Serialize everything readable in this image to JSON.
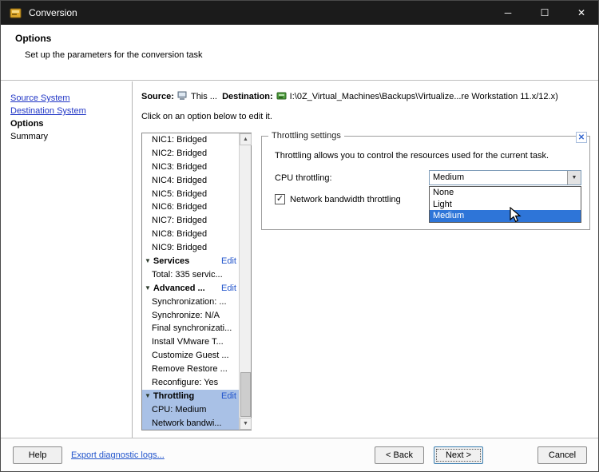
{
  "window": {
    "title": "Conversion",
    "controls": {
      "minimize": "─",
      "maximize": "☐",
      "close": "✕"
    }
  },
  "header": {
    "title": "Options",
    "subtitle": "Set up the parameters for the conversion task"
  },
  "wizard_nav": [
    {
      "label": "Source System"
    },
    {
      "label": "Destination System"
    },
    {
      "label": "Options"
    },
    {
      "label": "Summary"
    }
  ],
  "source_line": {
    "source_label": "Source:",
    "source_value": "This ...",
    "destination_label": "Destination:",
    "destination_value": "I:\\0Z_Virtual_Machines\\Backups\\Virtualize...re Workstation 11.x/12.x)"
  },
  "instruction": "Click on an option below to edit it.",
  "options_list": [
    {
      "label": "NIC1: Bridged",
      "type": "item"
    },
    {
      "label": "NIC2: Bridged",
      "type": "item"
    },
    {
      "label": "NIC3: Bridged",
      "type": "item"
    },
    {
      "label": "NIC4: Bridged",
      "type": "item"
    },
    {
      "label": "NIC5: Bridged",
      "type": "item"
    },
    {
      "label": "NIC6: Bridged",
      "type": "item"
    },
    {
      "label": "NIC7: Bridged",
      "type": "item"
    },
    {
      "label": "NIC8: Bridged",
      "type": "item"
    },
    {
      "label": "NIC9: Bridged",
      "type": "item"
    },
    {
      "label": "Services",
      "edit": "Edit",
      "type": "section"
    },
    {
      "label": "Total: 335 servic...",
      "type": "item"
    },
    {
      "label": "Advanced ...",
      "edit": "Edit",
      "type": "section"
    },
    {
      "label": "Synchronization: ...",
      "type": "item"
    },
    {
      "label": "Synchronize: N/A",
      "type": "item"
    },
    {
      "label": "Final synchronizati...",
      "type": "item"
    },
    {
      "label": "Install VMware T...",
      "type": "item"
    },
    {
      "label": "Customize Guest ...",
      "type": "item"
    },
    {
      "label": "Remove Restore ...",
      "type": "item"
    },
    {
      "label": "Reconfigure: Yes",
      "type": "item"
    },
    {
      "label": "Throttling",
      "edit": "Edit",
      "type": "section",
      "selected": true
    },
    {
      "label": "CPU: Medium",
      "type": "item",
      "selected": true
    },
    {
      "label": "Network bandwi...",
      "type": "item",
      "selected": true
    }
  ],
  "throttling_panel": {
    "title": "Throttling settings",
    "close_glyph": "✕",
    "description": "Throttling allows you to control the resources used for the current task.",
    "cpu_label": "CPU throttling:",
    "cpu_value": "Medium",
    "checkbox_label": "Network bandwidth throttling",
    "checkbox_checked": true,
    "checkbox_glyph": "✓",
    "dropdown_options": [
      "None",
      "Light",
      "Medium"
    ],
    "dropdown_selected": "Medium"
  },
  "footer": {
    "help": "Help",
    "export_link": "Export diagnostic logs...",
    "back": "< Back",
    "next": "Next >",
    "cancel": "Cancel"
  },
  "colors": {
    "titlebar": "#1b1b1b",
    "selection_list": "#a9c1e6",
    "selection_dropdown": "#2e75d8",
    "link": "#2255cc"
  }
}
